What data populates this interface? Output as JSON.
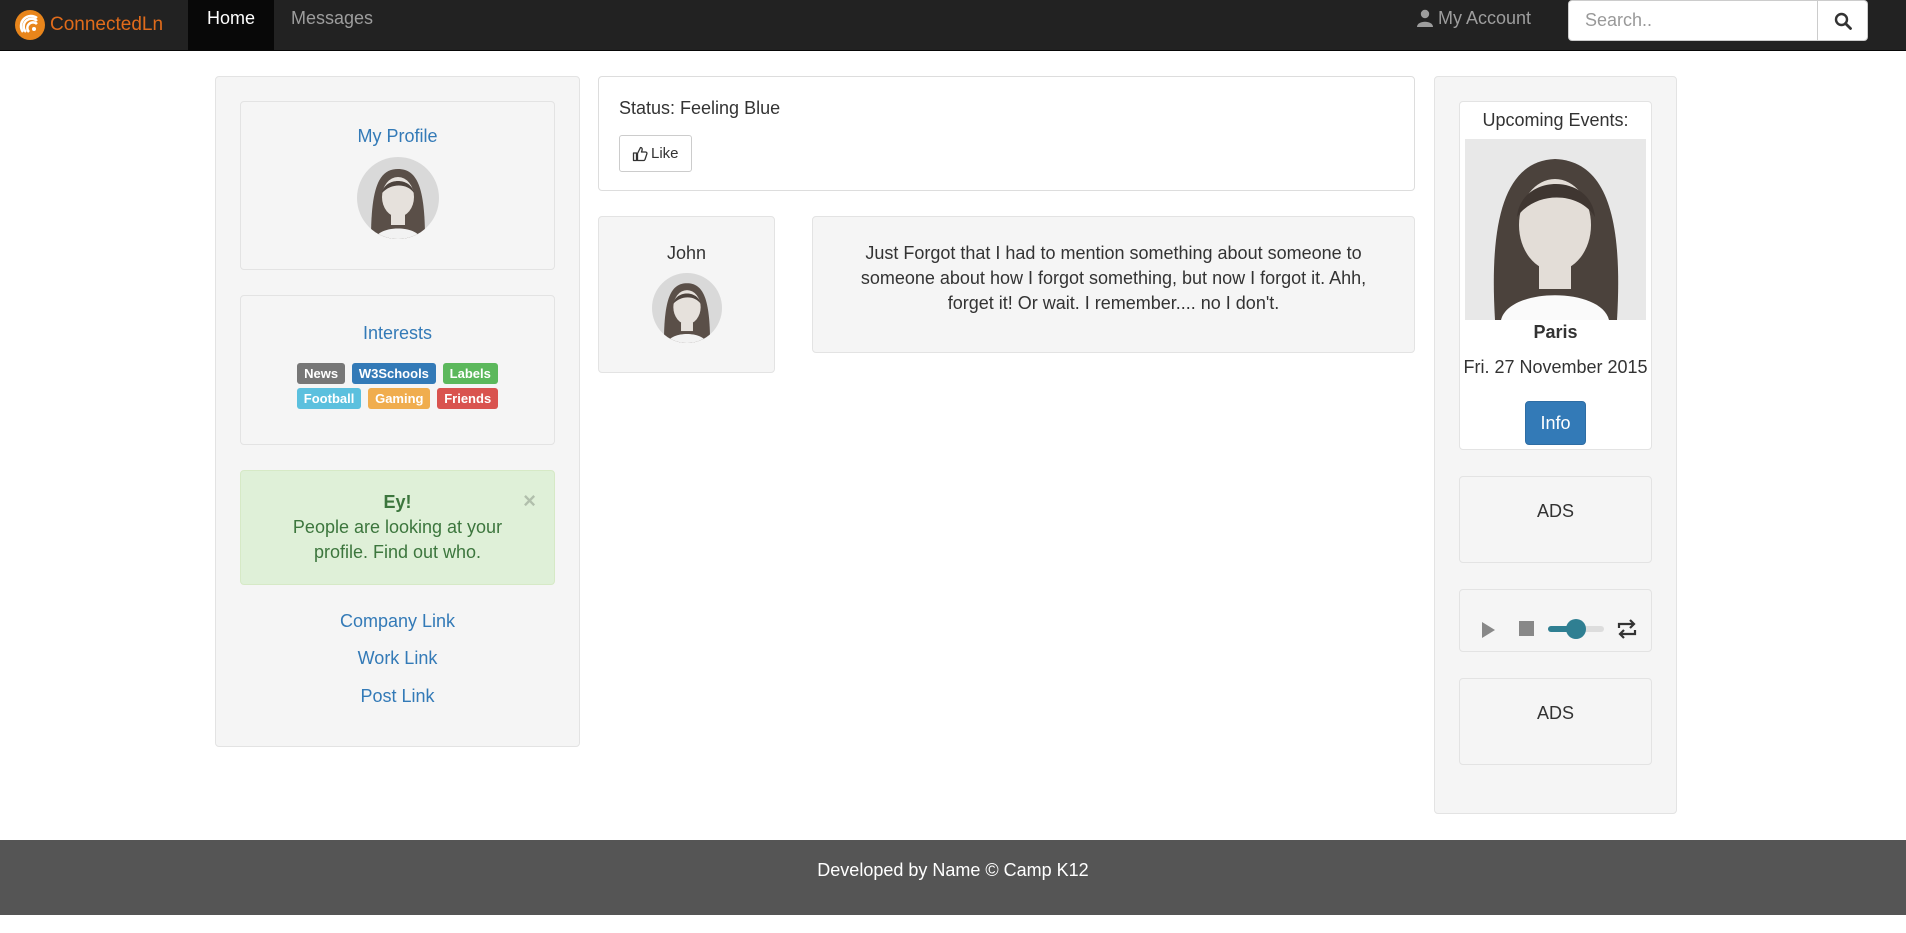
{
  "navbar": {
    "brand": "ConnectedLn",
    "tabs": [
      {
        "label": "Home",
        "active": true
      },
      {
        "label": "Messages",
        "active": false
      }
    ],
    "account_label": "My Account",
    "search_placeholder": "Search.."
  },
  "left": {
    "profile_title": "My Profile",
    "interests_title": "Interests",
    "labels": [
      {
        "text": "News",
        "color": "#777777"
      },
      {
        "text": "W3Schools",
        "color": "#337ab7"
      },
      {
        "text": "Labels",
        "color": "#5cb85c"
      },
      {
        "text": "Football",
        "color": "#5bc0de"
      },
      {
        "text": "Gaming",
        "color": "#f0ad4e"
      },
      {
        "text": "Friends",
        "color": "#d9534f"
      }
    ],
    "alert": {
      "title": "Ey!",
      "message": "People are looking at your profile. Find out who.",
      "close": "×"
    },
    "links": [
      "Company Link",
      "Work Link",
      "Post Link"
    ]
  },
  "main": {
    "status": "Status: Feeling Blue",
    "like_label": "Like",
    "post": {
      "author": "John",
      "text": "Just Forgot that I had to mention something about someone to someone about how I forgot something, but now I forgot it. Ahh, forget it! Or wait. I remember.... no I don't."
    }
  },
  "right": {
    "events_title": "Upcoming Events:",
    "event_city": "Paris",
    "event_date": "Fri. 27 November 2015",
    "info_label": "Info",
    "ads_1": "ADS",
    "ads_2": "ADS",
    "player": {
      "volume": 0.5
    }
  },
  "footer": {
    "text": "Developed by Name © Camp K12"
  },
  "colors": {
    "link": "#337ab7",
    "navbar": "#222222",
    "footer": "#555555",
    "brand": "#e06b1b"
  }
}
